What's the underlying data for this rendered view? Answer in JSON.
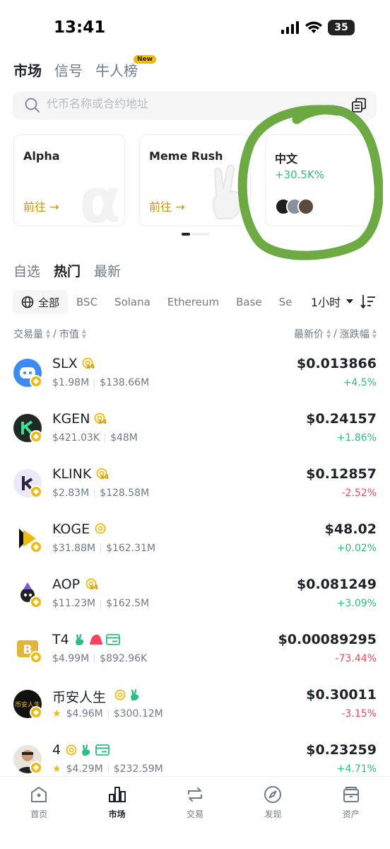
{
  "status_bar": {
    "time": "13:41",
    "battery": "35"
  },
  "top_tabs": [
    {
      "label": "市场",
      "active": true
    },
    {
      "label": "信号",
      "active": false
    },
    {
      "label": "牛人榜",
      "active": false,
      "badge": "New"
    }
  ],
  "search": {
    "placeholder": "代币名称或合约地址"
  },
  "cards": [
    {
      "title": "Alpha",
      "action": "前往 →"
    },
    {
      "title": "Meme Rush",
      "action": "前往 →"
    },
    {
      "title": "中文",
      "change": "+30.5K%"
    }
  ],
  "section_tabs": [
    {
      "label": "自选",
      "active": false
    },
    {
      "label": "热门",
      "active": true
    },
    {
      "label": "最新",
      "active": false
    }
  ],
  "chain_filters": [
    {
      "label": "全部",
      "active": true
    },
    {
      "label": "BSC"
    },
    {
      "label": "Solana"
    },
    {
      "label": "Ethereum"
    },
    {
      "label": "Base"
    },
    {
      "label": "Se"
    }
  ],
  "time_filter": "1小时",
  "columns": {
    "left_a": "交易量",
    "left_sep": "/",
    "left_b": "市值",
    "right_a": "最新价",
    "right_sep": "/",
    "right_b": "涨跌幅"
  },
  "tokens": [
    {
      "symbol": "SLX",
      "volume": "$1.98M",
      "mcap": "$138.66M",
      "price": "$0.013866",
      "change": "+4.5%",
      "direction": "up",
      "tags": [
        "alpha-x4"
      ]
    },
    {
      "symbol": "KGEN",
      "volume": "$421.03K",
      "mcap": "$48M",
      "price": "$0.24157",
      "change": "+1.86%",
      "direction": "up",
      "tags": [
        "alpha-x4"
      ]
    },
    {
      "symbol": "KLINK",
      "volume": "$2.83M",
      "mcap": "$128.58M",
      "price": "$0.12857",
      "change": "-2.52%",
      "direction": "down",
      "tags": [
        "alpha-x4"
      ]
    },
    {
      "symbol": "KOGE",
      "volume": "$31.88M",
      "mcap": "$162.31M",
      "price": "$48.02",
      "change": "+0.02%",
      "direction": "up",
      "tags": [
        "alpha"
      ]
    },
    {
      "symbol": "AOP",
      "volume": "$11.23M",
      "mcap": "$162.5M",
      "price": "$0.081249",
      "change": "+3.09%",
      "direction": "up",
      "tags": [
        "alpha-x4"
      ]
    },
    {
      "symbol": "T4",
      "volume": "$4.99M",
      "mcap": "$892.96K",
      "price": "$0.00089295",
      "change": "-73.44%",
      "direction": "down",
      "tags": [
        "hand",
        "hat",
        "card"
      ]
    },
    {
      "symbol": "币安人生",
      "volume": "$4.96M",
      "mcap": "$300.12M",
      "price": "$0.30011",
      "change": "-3.15%",
      "direction": "down",
      "tags": [
        "alpha",
        "hand"
      ],
      "starred": true
    },
    {
      "symbol": "4",
      "volume": "$4.29M",
      "mcap": "$232.59M",
      "price": "$0.23259",
      "change": "+4.71%",
      "direction": "up",
      "tags": [
        "alpha",
        "hand",
        "card"
      ],
      "starred": true
    }
  ],
  "bottom_nav": [
    {
      "label": "首页",
      "icon": "home-icon"
    },
    {
      "label": "市场",
      "icon": "market-icon",
      "active": true
    },
    {
      "label": "交易",
      "icon": "trade-icon"
    },
    {
      "label": "发现",
      "icon": "discover-icon"
    },
    {
      "label": "资产",
      "icon": "wallet-icon"
    }
  ],
  "colors": {
    "up": "#2ebd85",
    "down": "#f6465d",
    "brand": "#f0b90b",
    "link": "#c99400"
  }
}
